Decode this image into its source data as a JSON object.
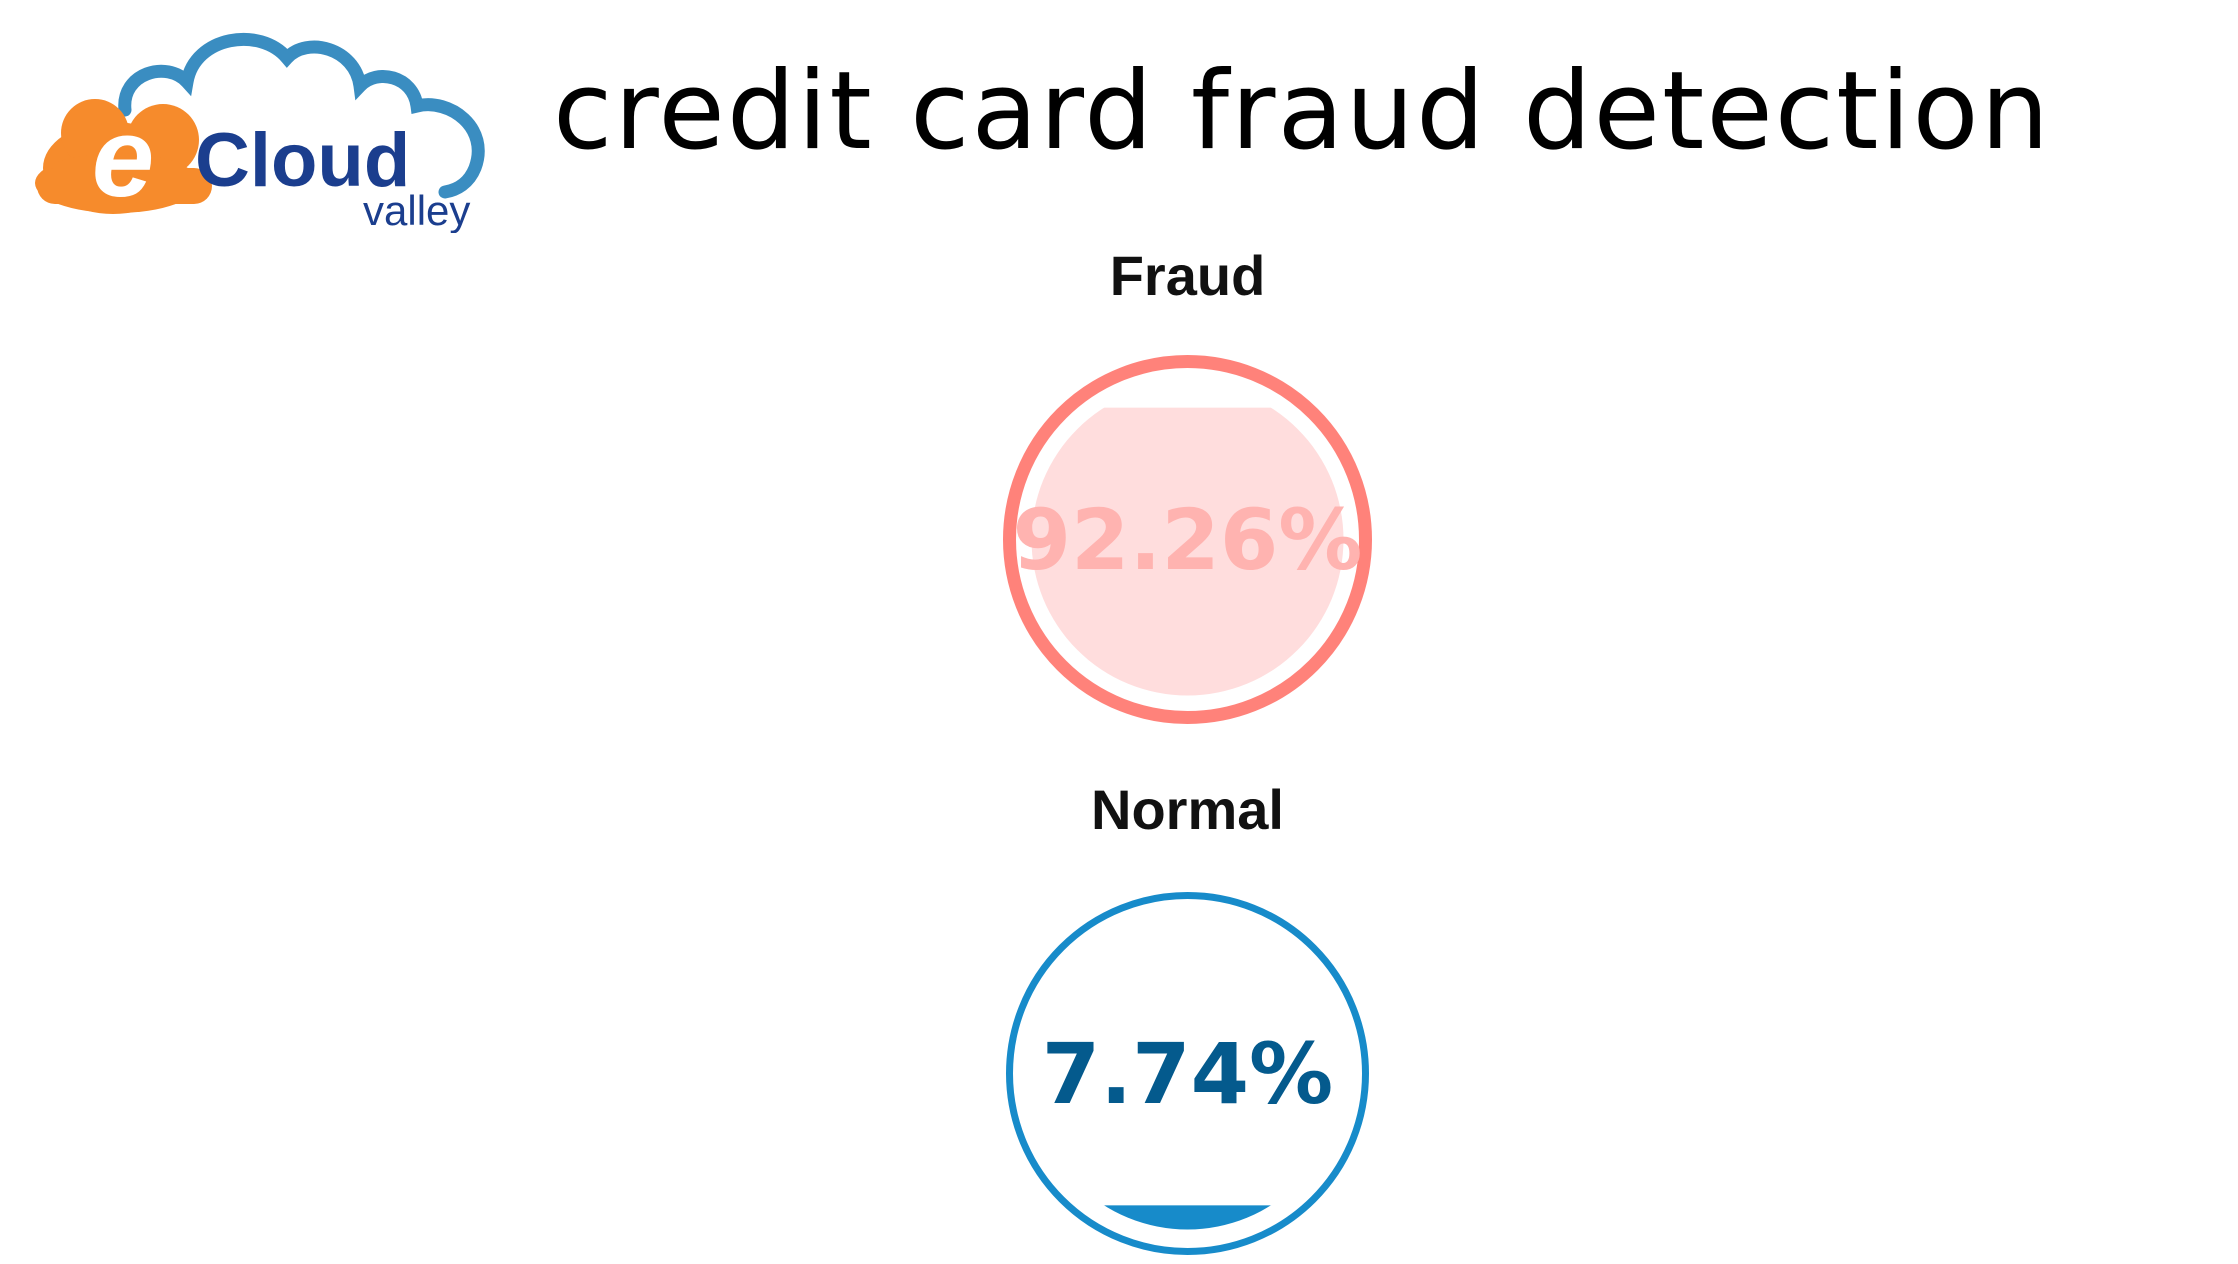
{
  "header": {
    "title": "credit card fraud detection",
    "logo": {
      "letter": "e",
      "word": "Cloud",
      "tagline": "valley",
      "colors": {
        "orange": "#F68B2C",
        "cloud_blue": "#3A8DC1",
        "navy": "#1B3E8E"
      }
    }
  },
  "gauges": [
    {
      "label": "Fraud",
      "value_text": "92.26%",
      "fill_percent": 92.26,
      "colors": {
        "ring": "#FF827A",
        "fill": "#FFDDDD",
        "text": "#FFB3B0"
      }
    },
    {
      "label": "Normal",
      "value_text": "7.74%",
      "fill_percent": 7.74,
      "colors": {
        "ring": "#178BCA",
        "fill": "#178BCA",
        "text": "#045A8D"
      }
    }
  ]
}
